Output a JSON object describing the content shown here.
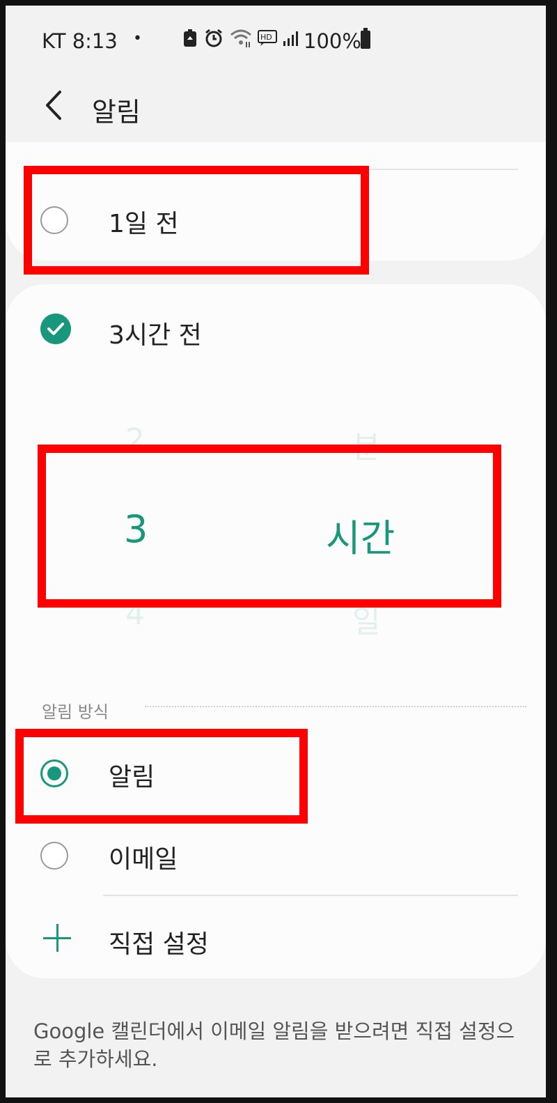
{
  "status_bar": {
    "carrier_time": "KT 8:13",
    "dot": "•",
    "battery_text": "100%",
    "icons": [
      "battery-saver-icon",
      "alarm-icon",
      "wifi-icon",
      "hd-voice-icon",
      "signal-icon",
      "battery-icon"
    ]
  },
  "header": {
    "title": "알림",
    "back_icon": "chevron-left-icon"
  },
  "reminder_options": [
    {
      "label": "1일 전",
      "selected": false
    },
    {
      "label": "3시간 전",
      "selected": true
    }
  ],
  "picker": {
    "number_prev": "2",
    "number_current": "3",
    "number_next": "4",
    "unit_prev": "분",
    "unit_current": "시간",
    "unit_next": "일"
  },
  "method_section": {
    "label": "알림 방식",
    "options": [
      {
        "label": "알림",
        "selected": true
      },
      {
        "label": "이메일",
        "selected": false
      }
    ],
    "custom_label": "직접 설정"
  },
  "footer": {
    "note": "Google 캘린더에서 이메일 알림을 받으려면 직접 설정으로 추가하세요."
  },
  "colors": {
    "accent": "#17987c",
    "highlight": "#ff0000",
    "background": "#f2f2f2",
    "card": "#fcfcfc"
  }
}
